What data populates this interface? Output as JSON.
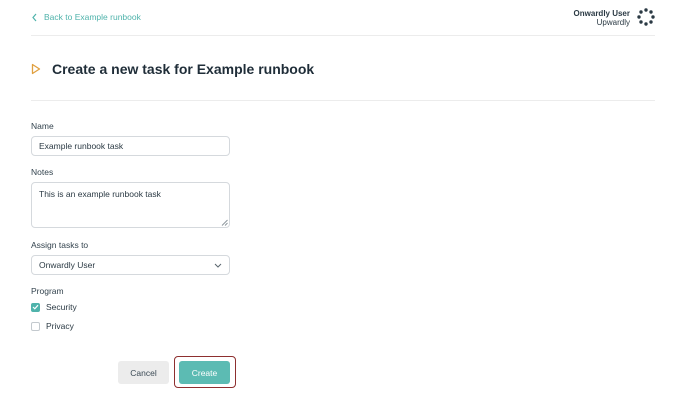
{
  "header": {
    "back_label": "Back to Example runbook",
    "user_name": "Onwardly User",
    "user_org": "Upwardly"
  },
  "page": {
    "title": "Create a new task for Example runbook"
  },
  "form": {
    "name_label": "Name",
    "name_value": "Example runbook task",
    "notes_label": "Notes",
    "notes_value": "This is an example runbook task",
    "assign_label": "Assign tasks to",
    "assign_value": "Onwardly User",
    "program_label": "Program",
    "programs": [
      {
        "label": "Security",
        "checked": true
      },
      {
        "label": "Privacy",
        "checked": false
      }
    ]
  },
  "actions": {
    "cancel_label": "Cancel",
    "create_label": "Create"
  },
  "colors": {
    "accent": "#4fb3ab",
    "create_button": "#5cbbb3",
    "focus_outline": "#8e2f2f",
    "title_icon": "#e0a040"
  },
  "icons": {
    "back": "chevron-left-icon",
    "title": "play-triangle-icon",
    "avatar": "dotted-ring-logo-icon",
    "select": "chevron-down-icon",
    "check": "checkmark-icon"
  }
}
